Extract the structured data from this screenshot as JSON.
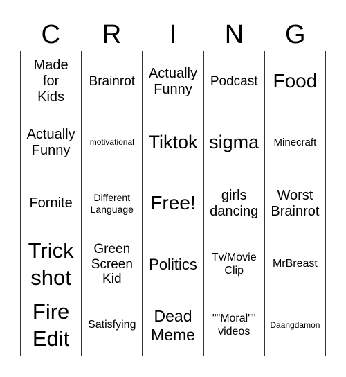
{
  "header": {
    "letters": [
      "C",
      "R",
      "I",
      "N",
      "G"
    ]
  },
  "cells": [
    [
      "Made for Kids",
      "Brainrot",
      "Actually Funny",
      "Podcast",
      "Food"
    ],
    [
      "Actually Funny",
      "motivational",
      "Tiktok",
      "sigma",
      "Minecraft"
    ],
    [
      "Fornite",
      "Different Language",
      "Free!",
      "girls dancing",
      "Worst Brainrot"
    ],
    [
      "Trick shot",
      "Green Screen Kid",
      "Politics",
      "Tv/Movie Clip",
      "MrBreast"
    ],
    [
      "Fire Edit",
      "Satisfying",
      "Dead Meme",
      "\"\"Moral\"\" videos",
      "Daangdamon"
    ]
  ]
}
